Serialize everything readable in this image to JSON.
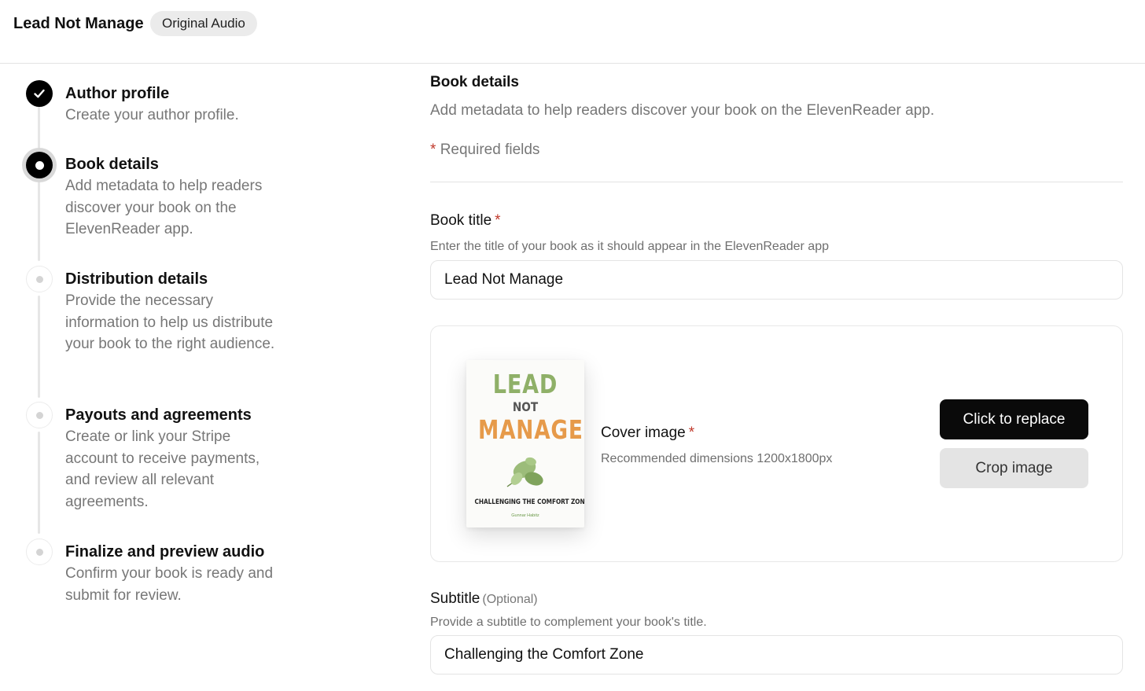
{
  "header": {
    "project_title": "Lead Not Manage",
    "badge": "Original Audio"
  },
  "stepper": {
    "steps": [
      {
        "title": "Author profile",
        "description": "Create your author profile.",
        "status": "complete"
      },
      {
        "title": "Book details",
        "description": "Add metadata to help readers discover your book on the ElevenReader app.",
        "status": "current"
      },
      {
        "title": "Distribution details",
        "description": "Provide the necessary information to help us distribute your book to the right audience.",
        "status": "pending"
      },
      {
        "title": "Payouts and agreements",
        "description": "Create or link your Stripe account to receive payments, and review all relevant agreements.",
        "status": "pending"
      },
      {
        "title": "Finalize and preview audio",
        "description": "Confirm your book is ready and submit for review.",
        "status": "pending"
      }
    ]
  },
  "form": {
    "section_title": "Book details",
    "section_description": "Add metadata to help readers discover your book on the ElevenReader app.",
    "required_star": "*",
    "required_note": "Required fields",
    "book_title": {
      "label": "Book title",
      "required_star": "*",
      "help": "Enter the title of your book as it should appear in the ElevenReader app",
      "value": "Lead Not Manage"
    },
    "cover": {
      "label": "Cover image",
      "required_star": "*",
      "help": "Recommended dimensions 1200x1800px",
      "replace_button": "Click to replace",
      "crop_button": "Crop image",
      "thumbnail": {
        "line1": "LEAD",
        "line2": "NOT",
        "line3": "MANAGE",
        "subtitle": "CHALLENGING THE COMFORT ZONE",
        "author": "Gunnar Habitz",
        "icon": "leaf-icon",
        "colors": {
          "lead": "#8fb068",
          "manage": "#e69a4a"
        }
      }
    },
    "subtitle": {
      "label": "Subtitle",
      "optional": "(Optional)",
      "help": "Provide a subtitle to complement your book's title.",
      "value": "Challenging the Comfort Zone"
    }
  },
  "colors": {
    "accent": "#0a0a0a",
    "required": "#c0392b",
    "muted_text": "#777777"
  }
}
